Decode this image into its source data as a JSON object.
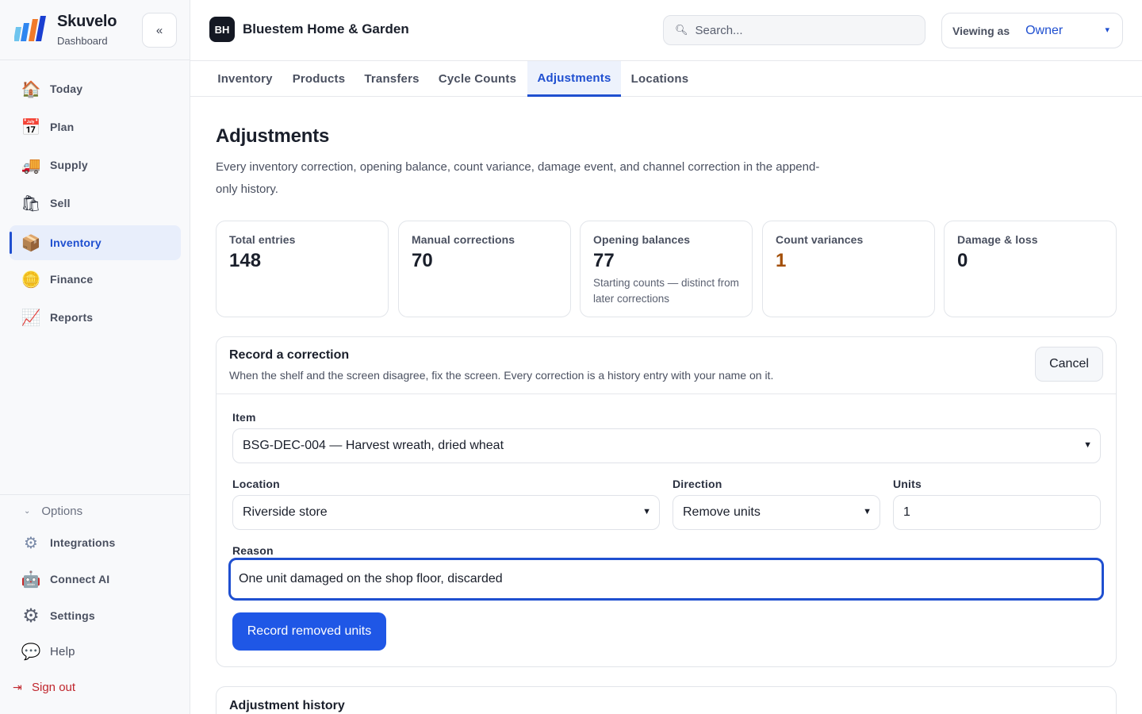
{
  "brand": {
    "name": "Skuvelo",
    "subtitle": "Dashboard",
    "logo_icon": "skuvelo-logo",
    "collapse_icon": "double-chevron-left-icon",
    "collapse_glyph": "«"
  },
  "sidebar": {
    "items": [
      {
        "label": "Today",
        "icon": "house-icon",
        "glyph": "🏠",
        "active": false
      },
      {
        "label": "Plan",
        "icon": "calendar-icon",
        "glyph": "📅",
        "active": false
      },
      {
        "label": "Supply",
        "icon": "truck-icon",
        "glyph": "🚚",
        "active": false
      },
      {
        "label": "Sell",
        "icon": "shopping-bag-icon",
        "glyph": "🛍",
        "active": false
      },
      {
        "label": "Inventory",
        "icon": "package-icon",
        "glyph": "📦",
        "active": true
      },
      {
        "label": "Finance",
        "icon": "coin-icon",
        "glyph": "🪙",
        "active": false
      },
      {
        "label": "Reports",
        "icon": "chart-icon",
        "glyph": "📈",
        "active": false
      }
    ],
    "options_label": "Options",
    "options_items": [
      {
        "label": "Integrations",
        "icon": "puzzle-gears-icon",
        "glyph": "⚙"
      },
      {
        "label": "Connect AI",
        "icon": "robot-icon",
        "glyph": "🤖"
      },
      {
        "label": "Settings",
        "icon": "gear-icon",
        "glyph": "⚙"
      },
      {
        "label": "Help",
        "icon": "speech-bubble-icon",
        "glyph": "💬"
      }
    ],
    "signout_label": "Sign out"
  },
  "header": {
    "org_initials": "BH",
    "org_name": "Bluestem Home & Garden",
    "search_placeholder": "Search...",
    "viewing_label": "Viewing as",
    "viewing_value": "Owner"
  },
  "tabs": [
    {
      "label": "Inventory",
      "active": false
    },
    {
      "label": "Products",
      "active": false
    },
    {
      "label": "Transfers",
      "active": false
    },
    {
      "label": "Cycle Counts",
      "active": false
    },
    {
      "label": "Adjustments",
      "active": true
    },
    {
      "label": "Locations",
      "active": false
    }
  ],
  "page": {
    "title": "Adjustments",
    "description": "Every inventory correction, opening balance, count variance, damage event, and channel correction in the append-only history."
  },
  "stats": [
    {
      "label": "Total entries",
      "value": "148",
      "note": ""
    },
    {
      "label": "Manual corrections",
      "value": "70",
      "note": ""
    },
    {
      "label": "Opening balances",
      "value": "77",
      "note": "Starting counts — distinct from later corrections"
    },
    {
      "label": "Count variances",
      "value": "1",
      "note": "",
      "color": "#a34f08"
    },
    {
      "label": "Damage & loss",
      "value": "0",
      "note": ""
    }
  ],
  "correction": {
    "title": "Record a correction",
    "subtitle": "When the shelf and the screen disagree, fix the screen. Every correction is a history entry with your name on it.",
    "cancel_label": "Cancel",
    "item_label": "Item",
    "item_value": "BSG-DEC-004 — Harvest wreath, dried wheat",
    "location_label": "Location",
    "location_value": "Riverside store",
    "direction_label": "Direction",
    "direction_value": "Remove units",
    "units_label": "Units",
    "units_value": "1",
    "reason_label": "Reason",
    "reason_value": "One unit damaged on the shop floor, discarded",
    "submit_label": "Record removed units"
  },
  "history": {
    "title": "Adjustment history"
  },
  "colors": {
    "accent": "#1f4fd0",
    "primary_button": "#1f57e6",
    "warning": "#a34f08",
    "danger": "#c0262d"
  }
}
